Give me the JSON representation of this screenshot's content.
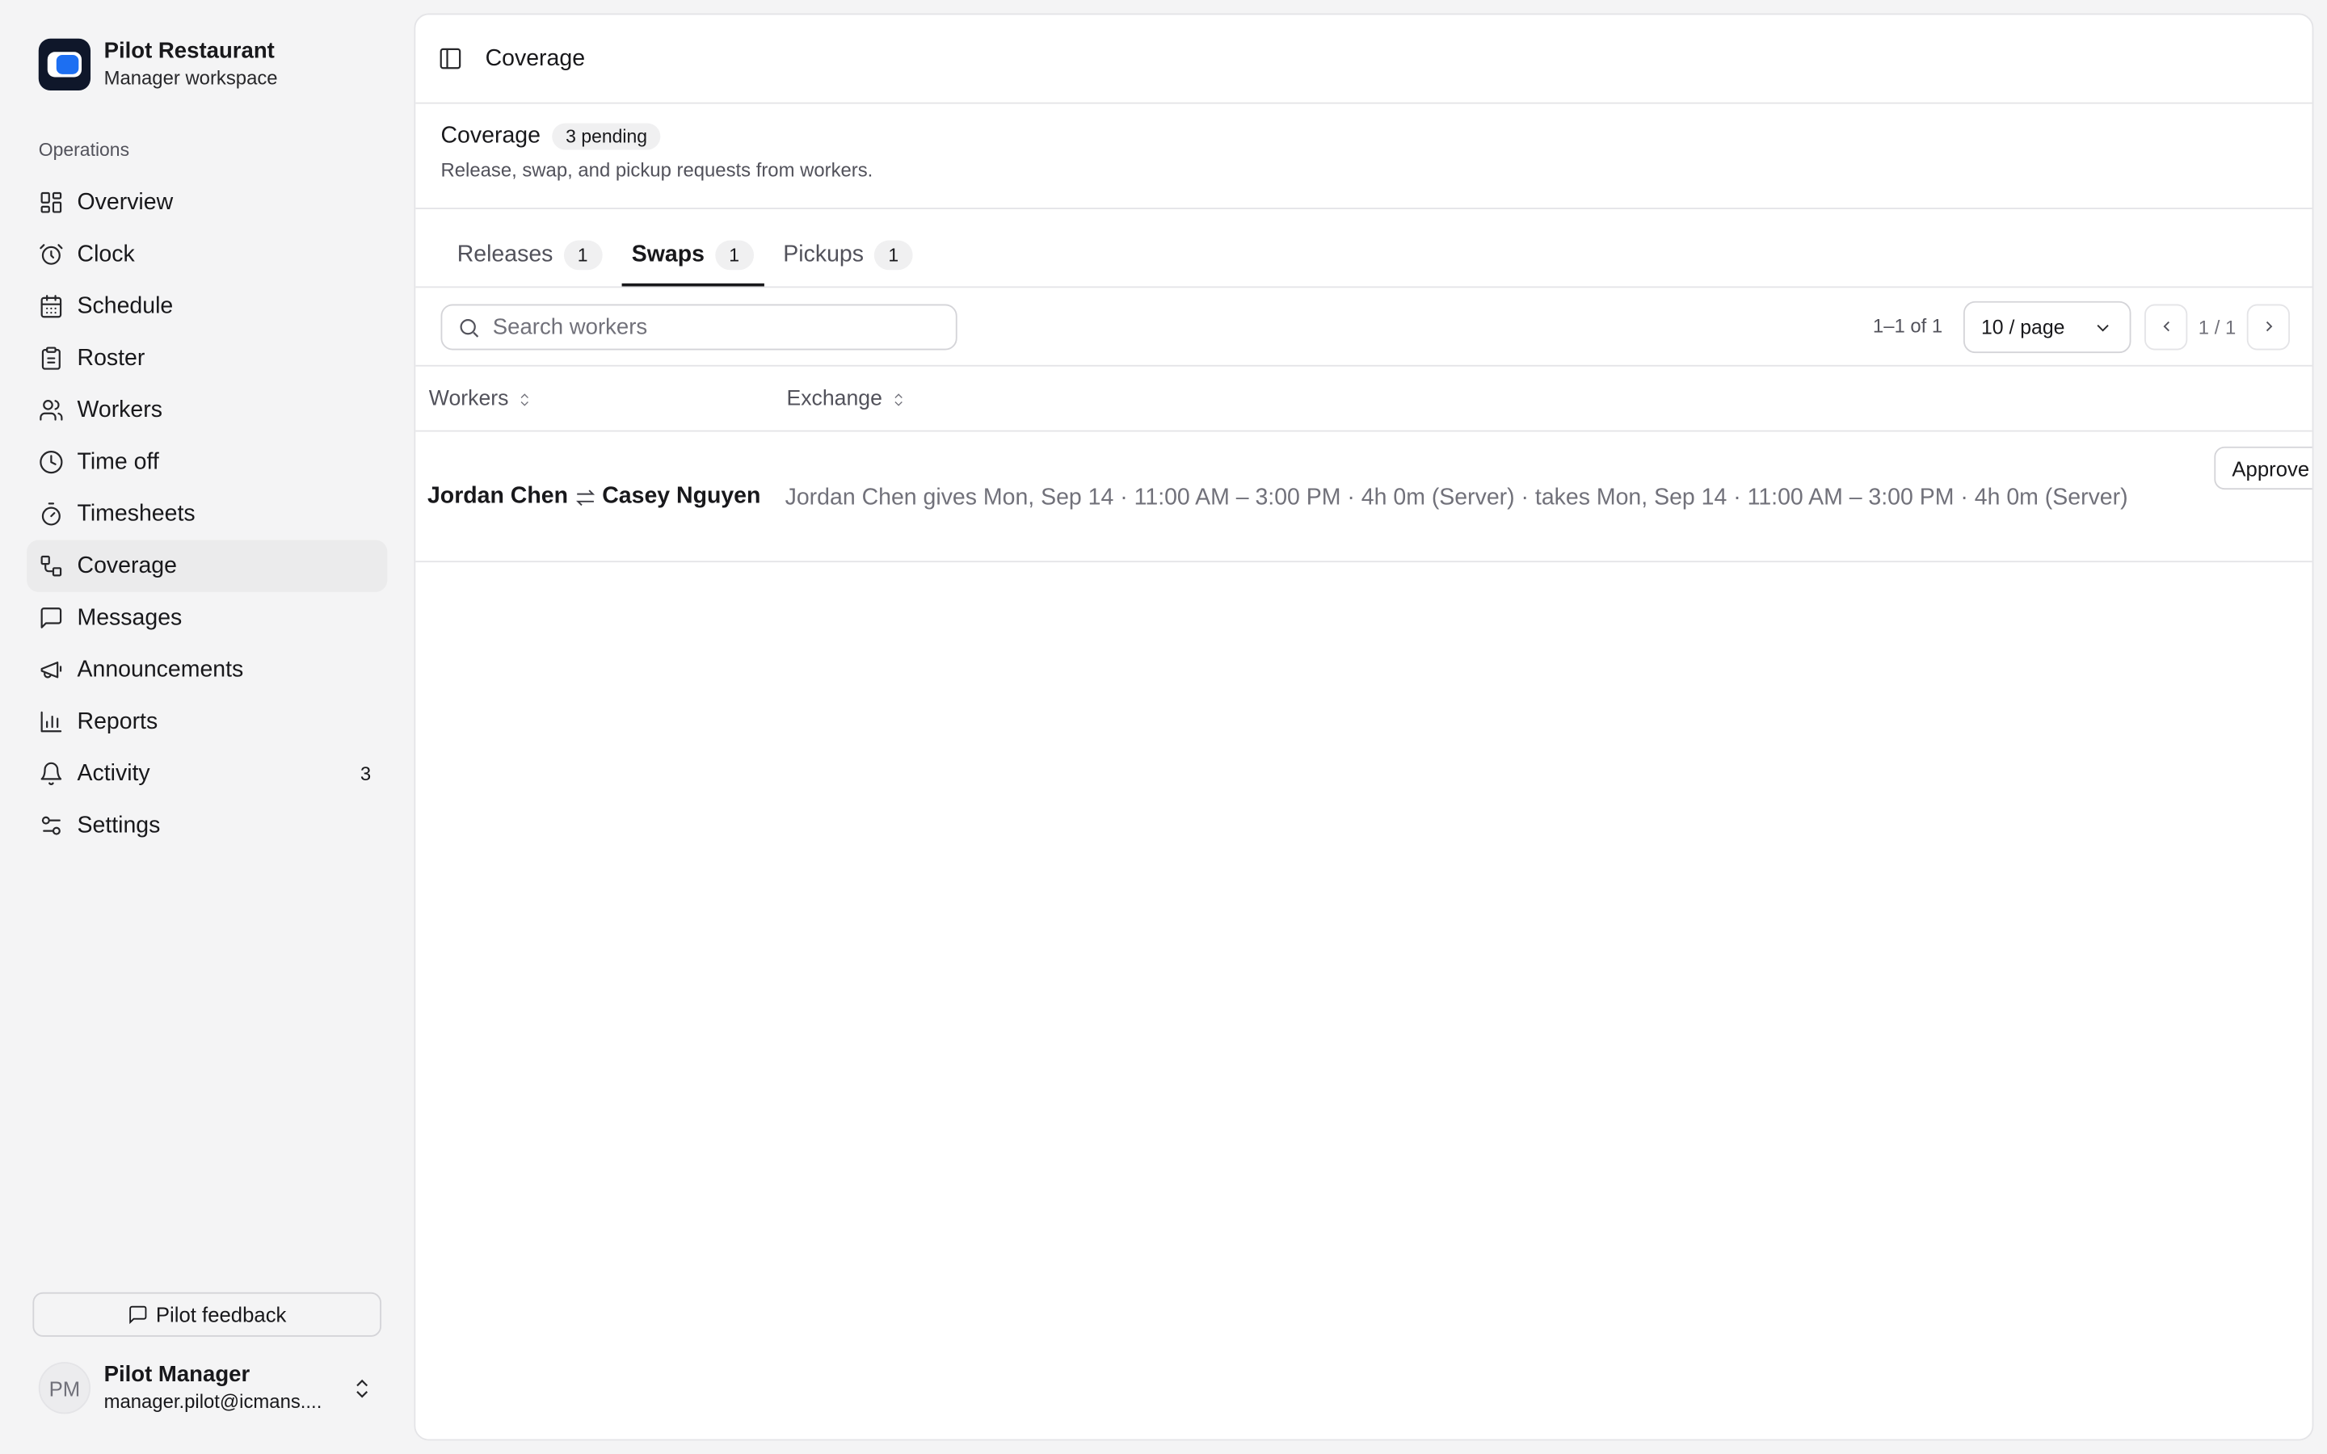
{
  "app": {
    "name": "Pilot Restaurant",
    "workspace": "Manager workspace"
  },
  "sidebar": {
    "section_label": "Operations",
    "items": [
      {
        "label": "Overview",
        "icon": "dashboard-icon"
      },
      {
        "label": "Clock",
        "icon": "alarm-clock-icon"
      },
      {
        "label": "Schedule",
        "icon": "calendar-icon"
      },
      {
        "label": "Roster",
        "icon": "clipboard-icon"
      },
      {
        "label": "Workers",
        "icon": "users-icon"
      },
      {
        "label": "Time off",
        "icon": "clock-icon"
      },
      {
        "label": "Timesheets",
        "icon": "timer-icon"
      },
      {
        "label": "Coverage",
        "icon": "coverage-icon",
        "active": true
      },
      {
        "label": "Messages",
        "icon": "message-icon"
      },
      {
        "label": "Announcements",
        "icon": "megaphone-icon"
      },
      {
        "label": "Reports",
        "icon": "bar-chart-icon"
      },
      {
        "label": "Activity",
        "icon": "bell-icon",
        "badge": "3"
      },
      {
        "label": "Settings",
        "icon": "sliders-icon"
      }
    ],
    "feedback_label": "Pilot feedback"
  },
  "user": {
    "initials": "PM",
    "name": "Pilot Manager",
    "email": "manager.pilot@icmans...."
  },
  "topbar": {
    "title": "Coverage"
  },
  "header": {
    "title": "Coverage",
    "pending_badge": "3 pending",
    "subtitle": "Release, swap, and pickup requests from workers."
  },
  "tabs": [
    {
      "label": "Releases",
      "count": "1"
    },
    {
      "label": "Swaps",
      "count": "1",
      "active": true
    },
    {
      "label": "Pickups",
      "count": "1"
    }
  ],
  "toolbar": {
    "search_placeholder": "Search workers",
    "range": "1–1 of 1",
    "page_size": "10 / page",
    "page_indicator": "1 / 1"
  },
  "table": {
    "columns": [
      "Workers",
      "Exchange"
    ],
    "rows": [
      {
        "worker_from": "Jordan Chen",
        "worker_to": "Casey Nguyen",
        "exchange": "Jordan Chen gives Mon, Sep 14 · 11:00 AM – 3:00 PM · 4h 0m (Server) · takes Mon, Sep 14 · 11:00 AM – 3:00 PM · 4h 0m (Server)",
        "action_label": "Approve"
      }
    ]
  },
  "colors": {
    "brand_accent": "#1d6ff2",
    "sidebar_bg": "#f4f4f5",
    "active_item_bg": "#ebebec"
  }
}
